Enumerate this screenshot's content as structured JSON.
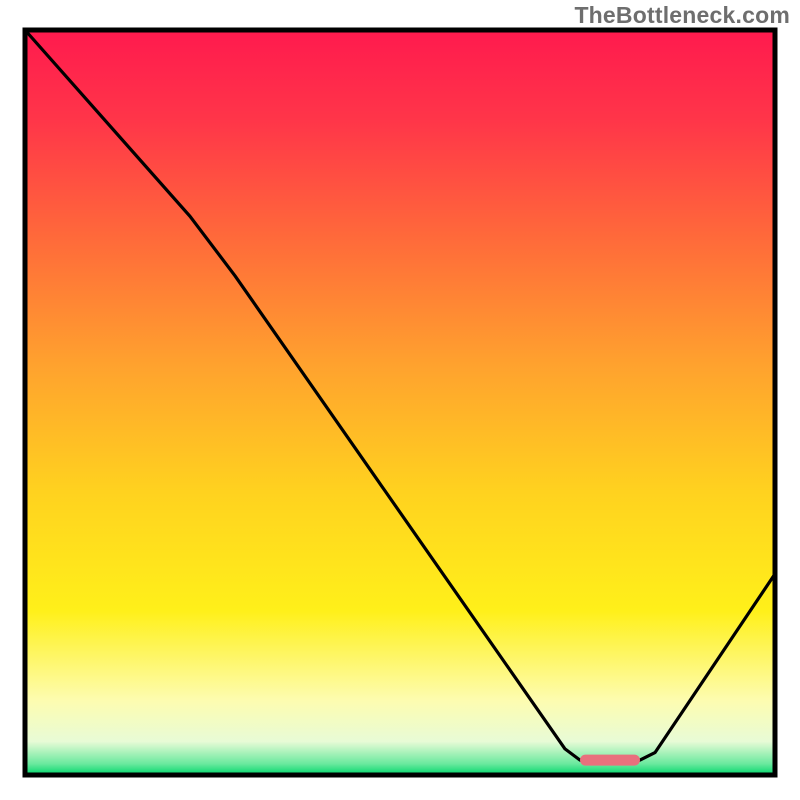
{
  "watermark": "TheBottleneck.com",
  "colors": {
    "border": "#000000",
    "curve": "#000000",
    "marker": "#e9707d",
    "gradient_stops": [
      {
        "offset": 0.0,
        "color": "#ff1a4e"
      },
      {
        "offset": 0.12,
        "color": "#ff3549"
      },
      {
        "offset": 0.28,
        "color": "#ff6a3a"
      },
      {
        "offset": 0.45,
        "color": "#ffa22e"
      },
      {
        "offset": 0.62,
        "color": "#ffd21f"
      },
      {
        "offset": 0.78,
        "color": "#fff01a"
      },
      {
        "offset": 0.9,
        "color": "#fdfcb0"
      },
      {
        "offset": 0.955,
        "color": "#e8fbd6"
      },
      {
        "offset": 0.985,
        "color": "#6ae99e"
      },
      {
        "offset": 1.0,
        "color": "#00d66b"
      }
    ]
  },
  "chart_data": {
    "type": "line",
    "title": "",
    "xlabel": "",
    "ylabel": "",
    "xlim": [
      0,
      100
    ],
    "ylim": [
      0,
      100
    ],
    "grid": false,
    "curve_points": [
      {
        "x": 0.0,
        "y": 100.0
      },
      {
        "x": 22.0,
        "y": 75.0
      },
      {
        "x": 28.0,
        "y": 67.0
      },
      {
        "x": 72.0,
        "y": 3.5
      },
      {
        "x": 74.0,
        "y": 2.0
      },
      {
        "x": 82.0,
        "y": 2.0
      },
      {
        "x": 84.0,
        "y": 3.0
      },
      {
        "x": 100.0,
        "y": 27.0
      }
    ],
    "optimum_marker": {
      "x_start": 74.0,
      "x_end": 82.0,
      "y": 2.0
    },
    "note": "x and y are percentages of the inner plot area; y=0 at bottom border, y=100 at top border."
  }
}
